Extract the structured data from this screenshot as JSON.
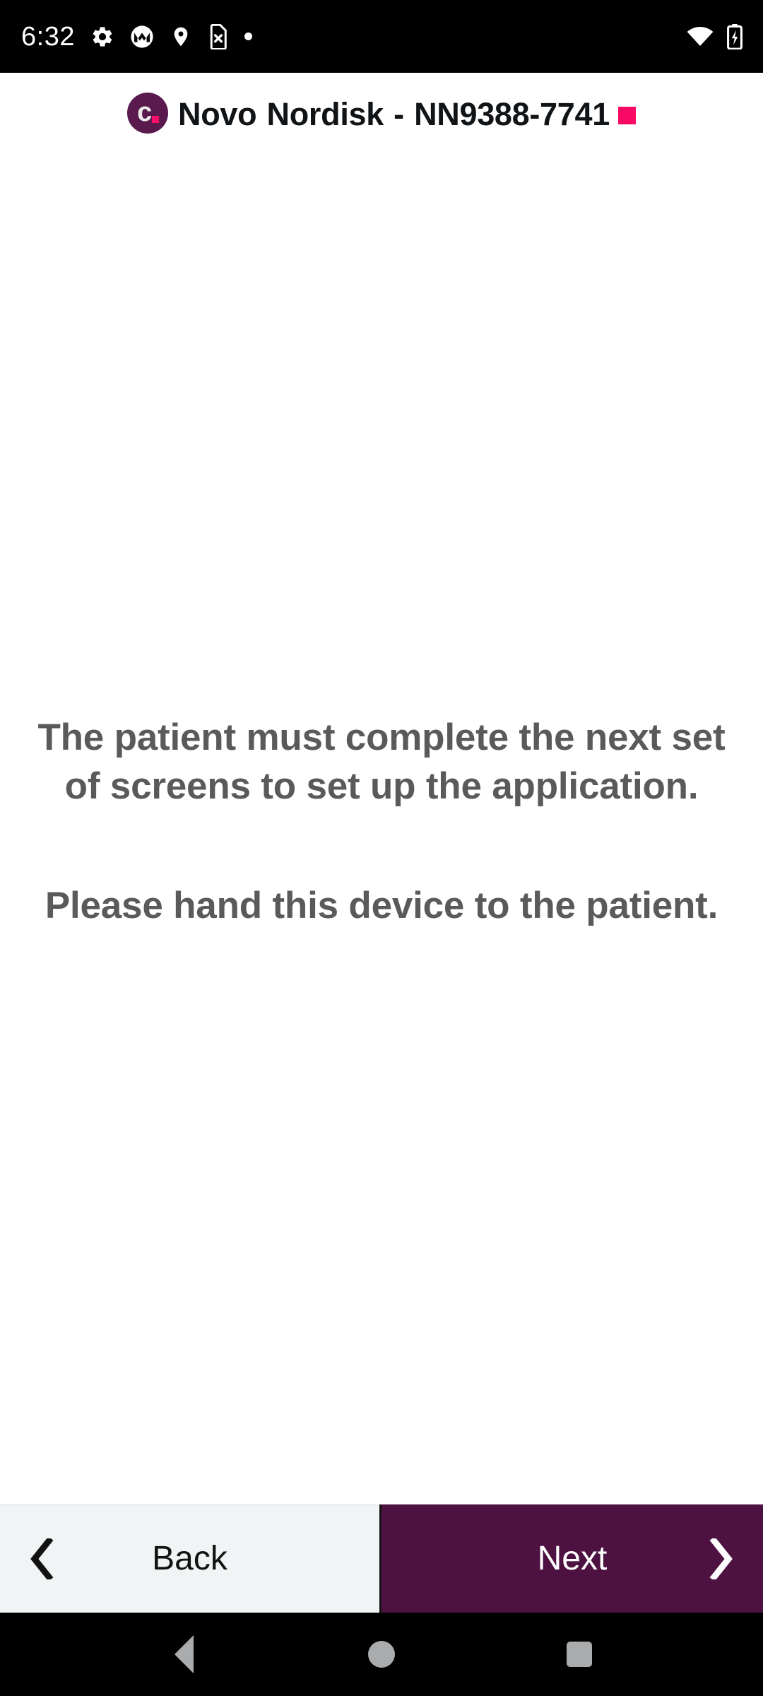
{
  "statusbar": {
    "time": "6:32",
    "left_icons": [
      "gear-icon",
      "motorola-logo-icon",
      "location-pin-icon",
      "sim-card-off-icon",
      "dot-icon"
    ],
    "right_icons": [
      "wifi-icon",
      "battery-charging-icon"
    ]
  },
  "header": {
    "logo_letter": "c",
    "logo_bg": "#5a1a4e",
    "logo_dot_color": "#f50f69",
    "title": "Novo Nordisk - NN9388-7741",
    "badge_color": "#fa0a64"
  },
  "main": {
    "paragraphs": [
      "The patient must complete the next set of screens to set up the application.",
      "Please hand this device to the patient."
    ],
    "text_color": "#5a5a5a"
  },
  "footer": {
    "back_label": "Back",
    "next_label": "Next",
    "back_bg": "#f1f4f5",
    "next_bg": "#4d1242",
    "back_icon": "chevron-left-icon",
    "next_icon": "chevron-right-icon"
  },
  "navbar": {
    "items": [
      "android-back-icon",
      "android-home-icon",
      "android-recents-icon"
    ],
    "tint": "#a9abad"
  }
}
